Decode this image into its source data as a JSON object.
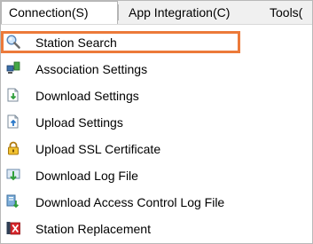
{
  "menubar": {
    "connection_label": "Connection(S)",
    "app_integration_label": "App Integration(C)",
    "tools_label": "Tools("
  },
  "menu": {
    "items": [
      {
        "label": "Station Search",
        "icon": "search-icon"
      },
      {
        "label": "Association Settings",
        "icon": "network-icon"
      },
      {
        "label": "Download Settings",
        "icon": "download-document-icon"
      },
      {
        "label": "Upload Settings",
        "icon": "upload-document-icon"
      },
      {
        "label": "Upload SSL Certificate",
        "icon": "lock-icon"
      },
      {
        "label": "Download Log File",
        "icon": "download-log-icon"
      },
      {
        "label": "Download Access Control Log File",
        "icon": "download-access-log-icon"
      },
      {
        "label": "Station Replacement",
        "icon": "replace-icon"
      }
    ]
  },
  "colors": {
    "highlight_border": "#ec7a3a",
    "menubar_bg": "#f0f0f0"
  }
}
